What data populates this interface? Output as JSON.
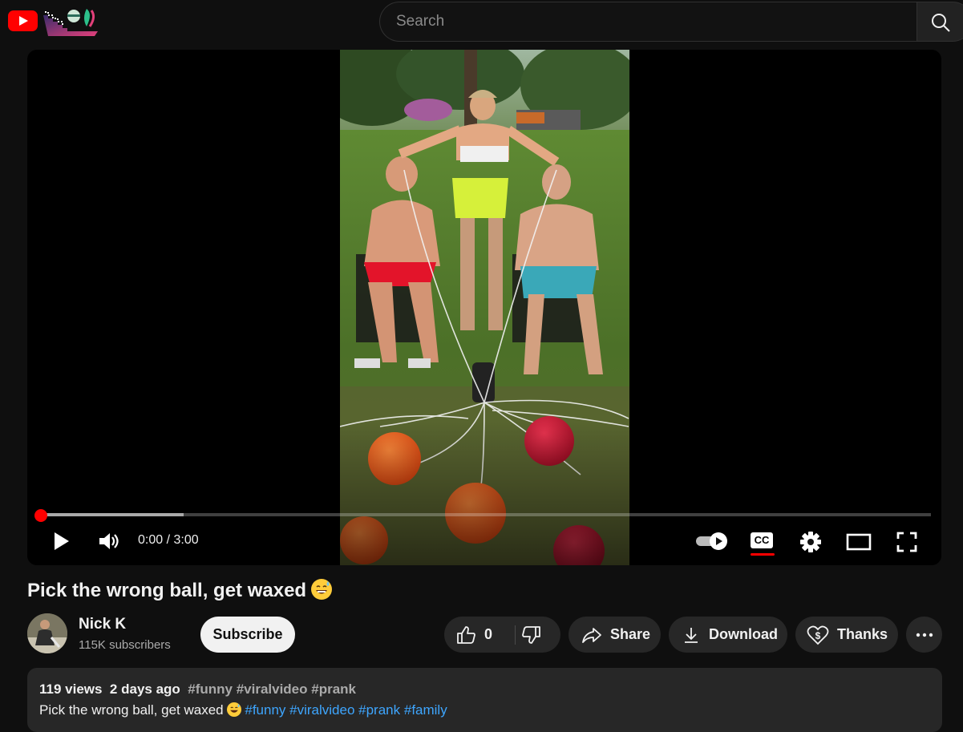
{
  "header": {
    "search_placeholder": "Search",
    "icons": [
      "youtube-logo-icon",
      "search-icon"
    ]
  },
  "player": {
    "time_current": "0:00",
    "time_separator": " / ",
    "time_total": "3:00",
    "played_fraction": 0.0,
    "buffered_fraction": 0.16,
    "cc_label": "CC",
    "autoplay_on": true
  },
  "video": {
    "title": "Pick the wrong ball, get waxed",
    "title_emoji": "😅"
  },
  "channel": {
    "name": "Nick K",
    "subscribers": "115K subscribers",
    "subscribe_label": "Subscribe"
  },
  "actions": {
    "like_count": "0",
    "share_label": "Share",
    "download_label": "Download",
    "thanks_label": "Thanks"
  },
  "description": {
    "views": "119 views",
    "date": "2 days ago",
    "tags": "#funny #viralvideo #prank",
    "text": "Pick the wrong ball, get waxed",
    "hashtags": [
      "#funny",
      "#viralvideo",
      "#prank",
      "#family"
    ]
  },
  "colors": {
    "background": "#0f0f0f",
    "accent_red": "#ff0000",
    "pill": "#272727",
    "link_blue": "#3ea6ff"
  }
}
